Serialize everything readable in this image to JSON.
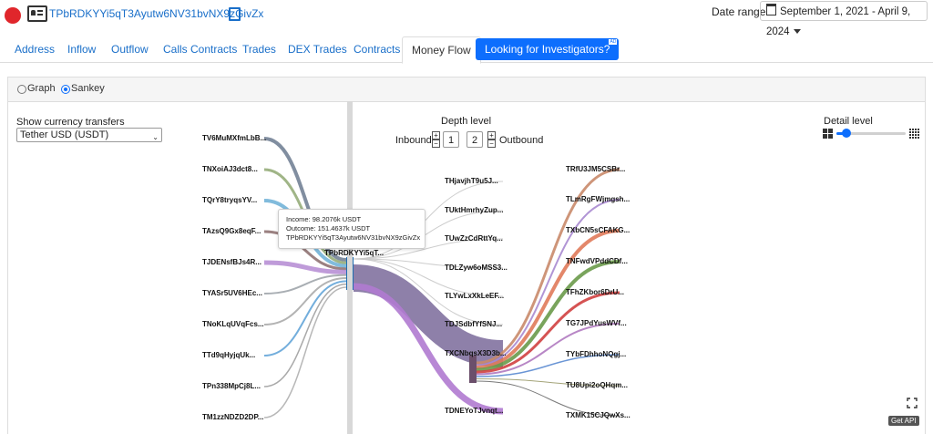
{
  "header": {
    "address": "TPbRDKYYi5qT3Ayutw6NV31bvNX9zGivZx",
    "date_range_label": "Date range",
    "date_range_value": "September 1, 2021 - April 9, 2024"
  },
  "tabs": [
    {
      "label": "Address"
    },
    {
      "label": "Inflow"
    },
    {
      "label": "Outflow"
    },
    {
      "label": "Calls Contracts"
    },
    {
      "label": "Trades"
    },
    {
      "label": "DEX Trades"
    },
    {
      "label": "Contracts"
    },
    {
      "label": "Money Flow",
      "active": true
    },
    {
      "label": "Looking for Investigators?",
      "badge": "AD"
    }
  ],
  "view": {
    "graph_label": "Graph",
    "sankey_label": "Sankey",
    "selected": "Sankey"
  },
  "controls": {
    "currency_label": "Show currency transfers",
    "currency_value": "Tether USD (USDT)",
    "depth_title": "Depth level",
    "inbound_label": "Inbound",
    "inbound_value": "1",
    "outbound_label": "Outbound",
    "outbound_value": "2",
    "detail_title": "Detail level",
    "detail_level": 0.15
  },
  "tooltip": {
    "income": "Income: 98.2076k USDT",
    "outcome": "Outcome: 151.4637k USDT",
    "address": "TPbRDKYYi5qT3Ayutw6NV31bvNX9zGivZx"
  },
  "sankey": {
    "center_node": "TPbRDKYYi5qT...",
    "inbound_nodes": [
      {
        "label": "TV6MuMXfmLbB...",
        "color": "#6b7a8f"
      },
      {
        "label": "TNXoiAJ3dct8...",
        "color": "#8fa872"
      },
      {
        "label": "TQrY8tryqsYV...",
        "color": "#6bafd6"
      },
      {
        "label": "TAzsQ9Gx8eqF...",
        "color": "#8a6b6b"
      },
      {
        "label": "TJDENsfBJs4R...",
        "color": "#b48ad2"
      },
      {
        "label": "TYASr5UV6HEc...",
        "color": "#9aa0a6"
      },
      {
        "label": "TNoKLqUVqFcs...",
        "color": "#a6a6a6"
      },
      {
        "label": "TTd9qHyjqUk...",
        "color": "#5aa0d6"
      },
      {
        "label": "TPn338MpCj8L...",
        "color": "#9a9a9a"
      },
      {
        "label": "TM1zzNDZD2DP...",
        "color": "#aaaaaa"
      }
    ],
    "level1_nodes": [
      {
        "label": "THjavjhT9u5J..."
      },
      {
        "label": "TUktHmrhyZup..."
      },
      {
        "label": "TUwZzCdRttYq..."
      },
      {
        "label": "TDLZyw6oMSS3..."
      },
      {
        "label": "TLYwLxXkLeEF..."
      },
      {
        "label": "TDJSdbfYfSNJ..."
      },
      {
        "label": "TXCNbqsX3D3b..."
      },
      {
        "label": "TDNEYoTJvnqt..."
      }
    ],
    "level2_nodes": [
      {
        "label": "TRfU3JM5CSBr...",
        "color": "#c98a6a"
      },
      {
        "label": "TLmRgFWjmgsh...",
        "color": "#a98ad0"
      },
      {
        "label": "TXbCN5sCFAKG...",
        "color": "#e07a5a"
      },
      {
        "label": "TNFwdVPddCDf...",
        "color": "#6a9a4a"
      },
      {
        "label": "TFhZKbor6DrU...",
        "color": "#d04040"
      },
      {
        "label": "TG7JPdYusWVf...",
        "color": "#b07ac0"
      },
      {
        "label": "TYbFDhhoNQgj...",
        "color": "#5a8ad0"
      },
      {
        "label": "TU8Upi2oQHqm...",
        "color": "#9a9a6a"
      },
      {
        "label": "TXMK15CJQwXs...",
        "color": "#6a6a6a"
      }
    ]
  },
  "footer": {
    "api_label": "Get API"
  }
}
